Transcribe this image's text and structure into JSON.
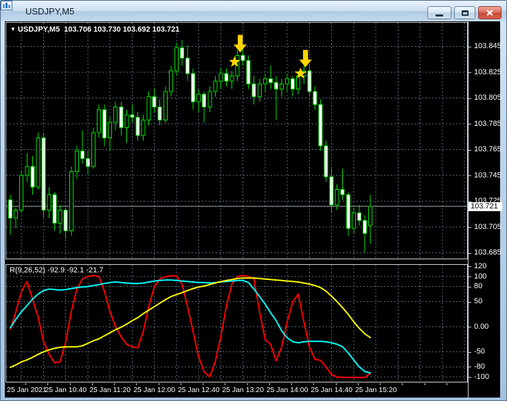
{
  "window": {
    "title": "USDJPY,M5",
    "icons": {
      "titlebar": "chart-icon",
      "minimize": "minimize-icon",
      "maximize": "restore-icon",
      "close": "close-icon",
      "symbol_marker": "triangle-down-icon",
      "signals": [
        "star-icon",
        "down-arrow-icon"
      ]
    }
  },
  "main_chart": {
    "symbol_marker": "▼",
    "ohlc_line": "USDJPY,M5  103.706 103.730 103.692 103.721",
    "bid_label": "103.721",
    "price_axis_labels": [
      "103.845",
      "103.825",
      "103.805",
      "103.785",
      "103.765",
      "103.745",
      "103.725",
      "103.705",
      "103.685"
    ]
  },
  "indicator_panel": {
    "label": "R(9,26,52) -92.9 -92.1 -21.7",
    "axis_labels": [
      "120",
      "100",
      "80",
      "50",
      "0.00",
      "-50",
      "-80",
      "-100"
    ]
  },
  "time_axis_labels": [
    "25 Jan 2021",
    "25 Jan 10:40",
    "25 Jan 11:20",
    "25 Jan 12:00",
    "25 Jan 12:40",
    "25 Jan 13:20",
    "25 Jan 14:00",
    "25 Jan 14:40",
    "25 Jan 15:20"
  ],
  "colors": {
    "background": "#000000",
    "grid": "#607184",
    "candle_outline": "#00e600",
    "bull_fill": "#000000",
    "bear_fill": "#ffffff",
    "bid_line": "#a8b0b8",
    "signal": "#ffd700",
    "wpr_fast": "#ff0000",
    "wpr_mid": "#00ffff",
    "wpr_slow": "#ffff00"
  },
  "chart_data": {
    "type": "candlestick+oscillator",
    "symbol": "USDJPY",
    "timeframe": "M5",
    "date": "25 Jan 2021",
    "last_ohlc": {
      "open": 103.706,
      "high": 103.73,
      "low": 103.692,
      "close": 103.721
    },
    "bid": 103.721,
    "price_axis_range": [
      103.685,
      103.845
    ],
    "candles": [
      [
        103.726,
        103.73,
        103.699,
        103.712
      ],
      [
        103.712,
        103.72,
        103.704,
        103.718
      ],
      [
        103.718,
        103.748,
        103.716,
        103.745
      ],
      [
        103.745,
        103.762,
        103.74,
        103.752
      ],
      [
        103.752,
        103.76,
        103.73,
        103.736
      ],
      [
        103.736,
        103.778,
        103.734,
        103.774
      ],
      [
        103.774,
        103.778,
        103.712,
        103.718
      ],
      [
        103.718,
        103.736,
        103.712,
        103.73
      ],
      [
        103.73,
        103.732,
        103.702,
        103.708
      ],
      [
        103.708,
        103.722,
        103.7,
        103.718
      ],
      [
        103.718,
        103.72,
        103.696,
        103.702
      ],
      [
        103.702,
        103.752,
        103.698,
        103.748
      ],
      [
        103.748,
        103.768,
        103.742,
        103.764
      ],
      [
        103.764,
        103.78,
        103.754,
        103.758
      ],
      [
        103.758,
        103.764,
        103.746,
        103.752
      ],
      [
        103.752,
        103.782,
        103.75,
        103.778
      ],
      [
        103.778,
        103.8,
        103.774,
        103.796
      ],
      [
        103.796,
        103.8,
        103.768,
        103.774
      ],
      [
        103.774,
        103.79,
        103.764,
        103.786
      ],
      [
        103.786,
        103.802,
        103.78,
        103.798
      ],
      [
        103.798,
        103.802,
        103.776,
        103.782
      ],
      [
        103.782,
        103.796,
        103.77,
        103.792
      ],
      [
        103.792,
        103.8,
        103.786,
        103.79
      ],
      [
        103.79,
        103.794,
        103.772,
        103.776
      ],
      [
        103.776,
        103.792,
        103.772,
        103.788
      ],
      [
        103.788,
        103.81,
        103.784,
        103.806
      ],
      [
        103.806,
        103.812,
        103.794,
        103.798
      ],
      [
        103.798,
        103.804,
        103.784,
        103.788
      ],
      [
        103.788,
        103.814,
        103.786,
        103.81
      ],
      [
        103.81,
        103.83,
        103.806,
        103.826
      ],
      [
        103.826,
        103.848,
        103.822,
        103.844
      ],
      [
        103.844,
        103.85,
        103.83,
        103.836
      ],
      [
        103.836,
        103.846,
        103.818,
        103.824
      ],
      [
        103.824,
        103.828,
        103.796,
        103.802
      ],
      [
        103.802,
        103.812,
        103.794,
        103.808
      ],
      [
        103.808,
        103.81,
        103.786,
        103.798
      ],
      [
        103.798,
        103.814,
        103.794,
        103.81
      ],
      [
        103.81,
        103.822,
        103.806,
        103.818
      ],
      [
        103.818,
        103.828,
        103.812,
        103.824
      ],
      [
        103.824,
        103.828,
        103.814,
        103.818
      ],
      [
        103.818,
        103.826,
        103.812,
        103.822
      ],
      [
        103.822,
        103.842,
        103.818,
        103.838
      ],
      [
        103.838,
        103.845,
        103.83,
        103.834
      ],
      [
        103.834,
        103.838,
        103.812,
        103.816
      ],
      [
        103.816,
        103.822,
        103.8,
        103.806
      ],
      [
        103.806,
        103.82,
        103.802,
        103.816
      ],
      [
        103.816,
        103.824,
        103.81,
        103.82
      ],
      [
        103.82,
        103.83,
        103.812,
        103.817
      ],
      [
        103.817,
        103.822,
        103.788,
        103.812
      ],
      [
        103.812,
        103.82,
        103.806,
        103.816
      ],
      [
        103.816,
        103.824,
        103.81,
        103.82
      ],
      [
        103.82,
        103.822,
        103.806,
        103.812
      ],
      [
        103.812,
        103.826,
        103.808,
        103.822
      ],
      [
        103.822,
        103.832,
        103.816,
        103.826
      ],
      [
        103.826,
        103.83,
        103.806,
        103.81
      ],
      [
        103.81,
        103.814,
        103.796,
        103.8
      ],
      [
        103.8,
        103.804,
        103.764,
        103.768
      ],
      [
        103.768,
        103.772,
        103.74,
        103.744
      ],
      [
        103.744,
        103.75,
        103.716,
        103.722
      ],
      [
        103.722,
        103.738,
        103.718,
        103.734
      ],
      [
        103.734,
        103.75,
        103.726,
        103.73
      ],
      [
        103.73,
        103.732,
        103.698,
        103.704
      ],
      [
        103.704,
        103.72,
        103.7,
        103.716
      ],
      [
        103.716,
        103.722,
        103.706,
        103.71
      ],
      [
        103.71,
        103.714,
        103.685,
        103.7
      ],
      [
        103.706,
        103.73,
        103.692,
        103.721
      ]
    ],
    "markers": [
      {
        "type": "star",
        "i": 40.5,
        "price": 103.833
      },
      {
        "type": "arrow_down",
        "i": 41.5,
        "price": 103.8405
      },
      {
        "type": "star",
        "i": 52.4,
        "price": 103.824
      },
      {
        "type": "arrow_down",
        "i": 53.3,
        "price": 103.829
      }
    ],
    "oscillator": {
      "name": "R(9,26,52)",
      "current_values": [
        -92.9,
        -92.1,
        -21.7
      ],
      "levels": [
        100,
        80,
        50,
        0,
        -50,
        -80,
        -100
      ],
      "range": [
        -100,
        120
      ],
      "series": [
        {
          "name": "R9",
          "color": "#ff0000",
          "values": [
            -5,
            30,
            70,
            90,
            55,
            20,
            -30,
            -55,
            -72,
            -70,
            -30,
            30,
            75,
            95,
            100,
            102,
            100,
            70,
            30,
            0,
            -20,
            -35,
            -40,
            -42,
            -10,
            40,
            80,
            95,
            100,
            101,
            101,
            85,
            40,
            -10,
            -60,
            -90,
            -100,
            -70,
            -20,
            40,
            85,
            100,
            102,
            100,
            95,
            30,
            -25,
            -35,
            -68,
            -40,
            10,
            50,
            65,
            10,
            -40,
            -65,
            -67,
            -80,
            -95,
            -100,
            -101,
            -101,
            -101,
            -101,
            -101,
            -92.9
          ]
        },
        {
          "name": "R26",
          "color": "#00ffff",
          "values": [
            -2,
            15,
            30,
            42,
            55,
            65,
            72,
            75,
            74,
            73,
            74,
            76,
            78,
            79,
            80,
            82,
            84,
            86,
            88,
            89,
            88,
            87,
            86,
            86,
            87,
            89,
            91,
            92,
            93,
            93,
            92,
            91,
            90,
            89,
            88,
            88,
            87,
            88,
            89,
            90,
            91,
            92,
            92,
            88,
            75,
            60,
            45,
            28,
            12,
            -8,
            -22,
            -30,
            -32,
            -30,
            -29,
            -29,
            -29,
            -30,
            -32,
            -35,
            -40,
            -52,
            -66,
            -80,
            -89,
            -92.1
          ]
        },
        {
          "name": "R52",
          "color": "#ffff00",
          "values": [
            -81,
            -76,
            -70,
            -66,
            -61,
            -55,
            -50,
            -46,
            -43,
            -41,
            -40,
            -40,
            -40,
            -38,
            -33,
            -28,
            -24,
            -18,
            -12,
            -6,
            -1,
            5,
            12,
            18,
            26,
            33,
            40,
            47,
            54,
            60,
            64,
            68,
            72,
            76,
            79,
            81,
            84,
            87,
            90,
            92,
            94,
            96,
            97,
            97,
            97,
            96,
            95,
            94,
            93,
            92,
            91,
            90,
            89,
            87,
            85,
            82,
            78,
            71,
            61,
            50,
            38,
            25,
            10,
            -3,
            -14,
            -21.7
          ]
        }
      ]
    }
  }
}
